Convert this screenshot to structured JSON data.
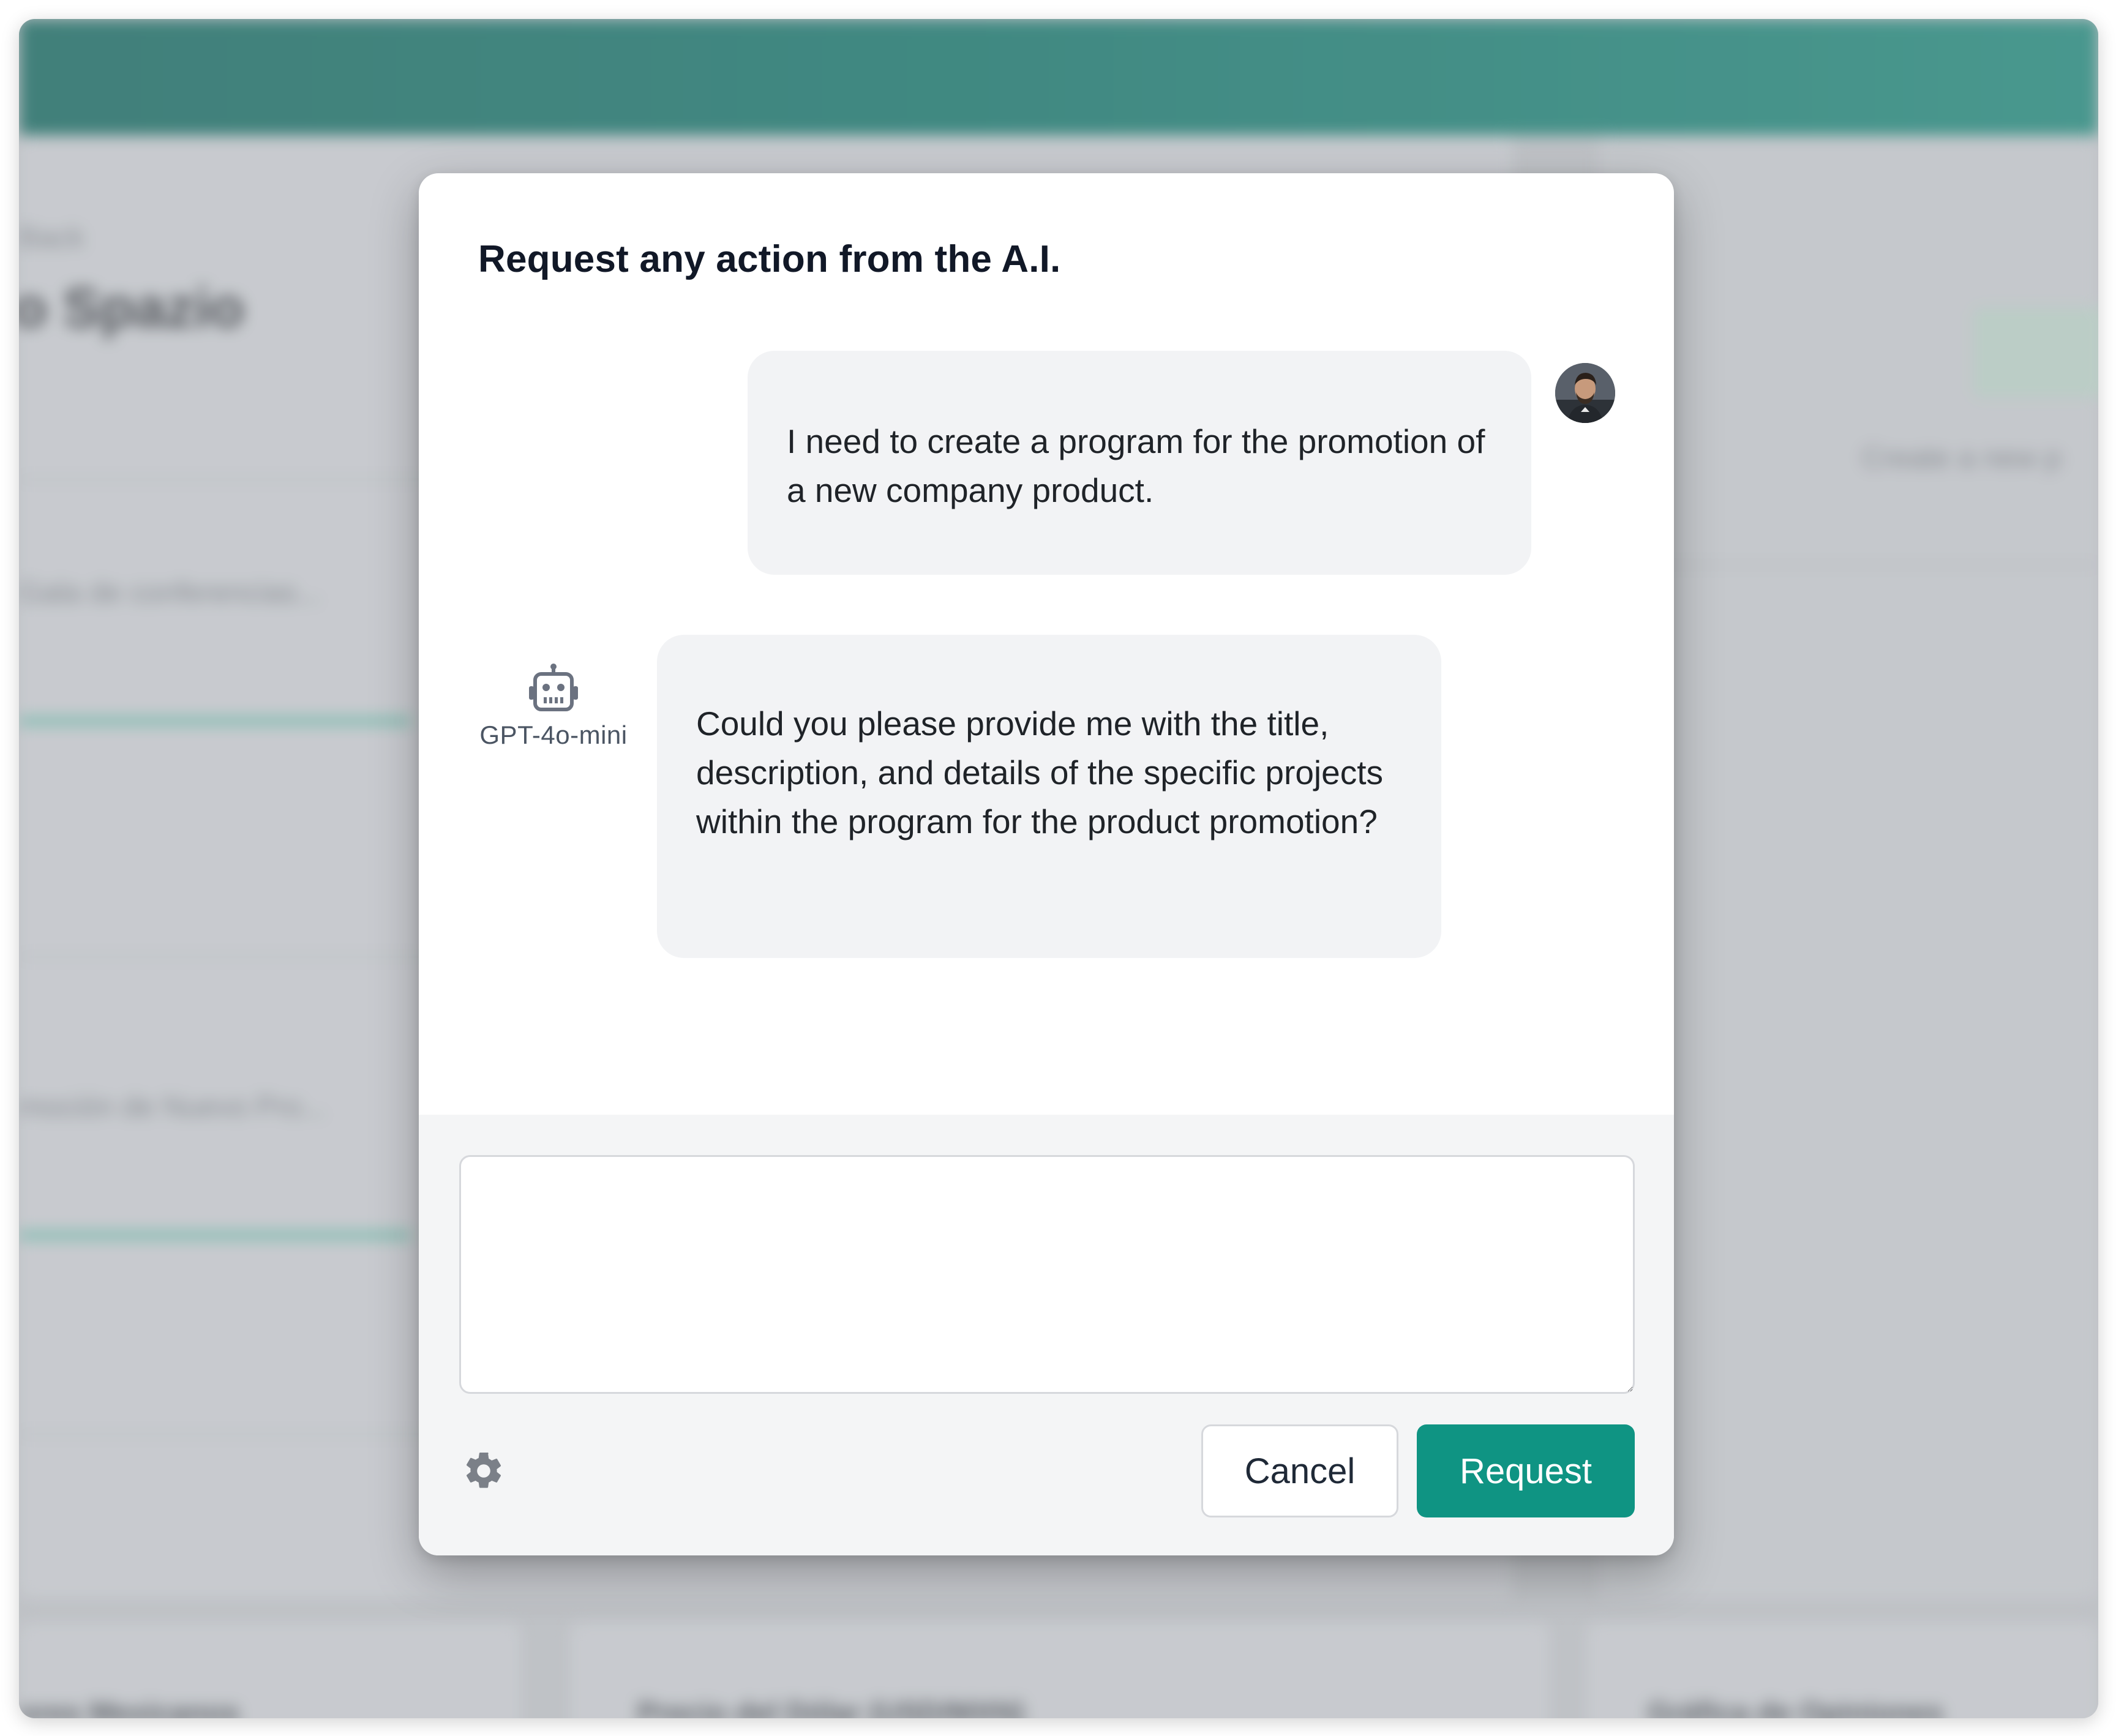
{
  "background": {
    "header_color": "#2e857b",
    "breadcrumb": "Back",
    "page_title": "o Spazio",
    "item1": "Gala de conferencias...",
    "item2": "moción de Nuevo Pro...",
    "right_action": "Create a new p",
    "bottom_card1": "ores Mexicanos",
    "bottom_card2": "Precio del Dólar (USD/MXN)",
    "bottom_card3": "Gráfica de Opiniones"
  },
  "modal": {
    "title": "Request any action from the A.I.",
    "messages": [
      {
        "role": "user",
        "text": "I need to create a program for the promotion of a new company product."
      },
      {
        "role": "assistant",
        "model": "GPT-4o-mini",
        "text": "Could you please provide me with the title, description, and details of the specific projects within the program for the product promotion?"
      }
    ],
    "input": {
      "value": "",
      "placeholder": ""
    },
    "icons": {
      "settings": "gear-icon",
      "assistant": "robot-icon",
      "user": "user-avatar"
    },
    "buttons": {
      "cancel": "Cancel",
      "request": "Request"
    },
    "colors": {
      "primary": "#0f9483",
      "bubble": "#f2f3f5",
      "footer": "#f4f5f6"
    }
  }
}
